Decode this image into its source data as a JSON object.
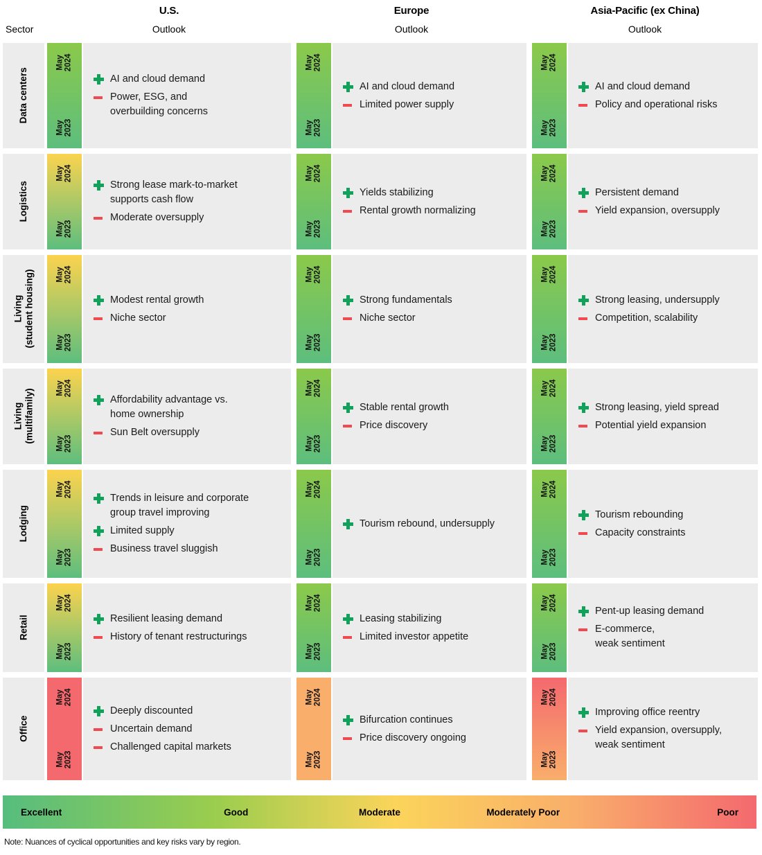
{
  "columns": {
    "sector_header": "Sector",
    "regions": [
      {
        "name": "U.S.",
        "sub": "Outlook"
      },
      {
        "name": "Europe",
        "sub": "Outlook"
      },
      {
        "name": "Asia-Pacific (ex China)",
        "sub": "Outlook"
      }
    ]
  },
  "scale_labels": {
    "top": "May\n2024",
    "bottom": "May\n2023"
  },
  "colors": {
    "panel_bg": "#ececec",
    "plus": "#12a15a",
    "minus": "#f0494f",
    "excellent": "#56bd7e",
    "good": "#9acd4e",
    "moderate": "#fbd45a",
    "moderately_poor": "#f9ae6b",
    "poor": "#f4696e"
  },
  "rows": [
    {
      "sector": "Data centers",
      "cells": [
        {
          "region": "U.S.",
          "grad_top": "#8bc94a",
          "grad_bottom": "#5dbe7e",
          "bullets": [
            {
              "type": "plus",
              "text": "AI and cloud demand"
            },
            {
              "type": "minus",
              "text": "Power, ESG, and\noverbuilding concerns"
            }
          ]
        },
        {
          "region": "Europe",
          "grad_top": "#8bc94a",
          "grad_bottom": "#5dbe7e",
          "bullets": [
            {
              "type": "plus",
              "text": "AI and cloud demand"
            },
            {
              "type": "minus",
              "text": "Limited power supply"
            }
          ]
        },
        {
          "region": "Asia-Pacific (ex China)",
          "grad_top": "#8bc94a",
          "grad_bottom": "#5dbe7e",
          "bullets": [
            {
              "type": "plus",
              "text": "AI and cloud demand"
            },
            {
              "type": "minus",
              "text": "Policy and operational risks"
            }
          ]
        }
      ]
    },
    {
      "sector": "Logistics",
      "cells": [
        {
          "region": "U.S.",
          "grad_top": "#fbd34f",
          "grad_bottom": "#5dbe7e",
          "bullets": [
            {
              "type": "plus",
              "text": "Strong lease mark-to-market\nsupports cash flow"
            },
            {
              "type": "minus",
              "text": "Moderate oversupply"
            }
          ]
        },
        {
          "region": "Europe",
          "grad_top": "#8bc94a",
          "grad_bottom": "#5dbe7e",
          "bullets": [
            {
              "type": "plus",
              "text": "Yields stabilizing"
            },
            {
              "type": "minus",
              "text": "Rental growth normalizing"
            }
          ]
        },
        {
          "region": "Asia-Pacific (ex China)",
          "grad_top": "#8bc94a",
          "grad_bottom": "#5dbe7e",
          "bullets": [
            {
              "type": "plus",
              "text": "Persistent demand"
            },
            {
              "type": "minus",
              "text": "Yield expansion, oversupply"
            }
          ]
        }
      ]
    },
    {
      "sector": "Living\n(student housing)",
      "cells": [
        {
          "region": "U.S.",
          "grad_top": "#fcd34e",
          "grad_bottom": "#5dbe7e",
          "bullets": [
            {
              "type": "plus",
              "text": "Modest rental growth"
            },
            {
              "type": "minus",
              "text": "Niche sector"
            }
          ]
        },
        {
          "region": "Europe",
          "grad_top": "#8bc94a",
          "grad_bottom": "#5dbe7e",
          "bullets": [
            {
              "type": "plus",
              "text": "Strong fundamentals"
            },
            {
              "type": "minus",
              "text": "Niche sector"
            }
          ]
        },
        {
          "region": "Asia-Pacific (ex China)",
          "grad_top": "#8bc94a",
          "grad_bottom": "#5dbe7e",
          "bullets": [
            {
              "type": "plus",
              "text": "Strong leasing, undersupply"
            },
            {
              "type": "minus",
              "text": "Competition, scalability"
            }
          ]
        }
      ]
    },
    {
      "sector": "Living\n(multifamily)",
      "cells": [
        {
          "region": "U.S.",
          "grad_top": "#fcd34e",
          "grad_bottom": "#5dbe7e",
          "bullets": [
            {
              "type": "plus",
              "text": "Affordability advantage vs.\nhome ownership"
            },
            {
              "type": "minus",
              "text": "Sun Belt oversupply"
            }
          ]
        },
        {
          "region": "Europe",
          "grad_top": "#8bc94a",
          "grad_bottom": "#5dbe7e",
          "bullets": [
            {
              "type": "plus",
              "text": "Stable rental growth"
            },
            {
              "type": "minus",
              "text": "Price discovery"
            }
          ]
        },
        {
          "region": "Asia-Pacific (ex China)",
          "grad_top": "#8bc94a",
          "grad_bottom": "#5dbe7e",
          "bullets": [
            {
              "type": "plus",
              "text": "Strong leasing, yield spread"
            },
            {
              "type": "minus",
              "text": "Potential yield expansion"
            }
          ]
        }
      ]
    },
    {
      "sector": "Lodging",
      "cells": [
        {
          "region": "U.S.",
          "grad_top": "#fcd34e",
          "grad_bottom": "#5dbe7e",
          "bullets": [
            {
              "type": "plus",
              "text": "Trends in leisure and corporate\ngroup travel improving"
            },
            {
              "type": "plus",
              "text": "Limited supply"
            },
            {
              "type": "minus",
              "text": "Business travel sluggish"
            }
          ]
        },
        {
          "region": "Europe",
          "grad_top": "#8bc94a",
          "grad_bottom": "#5dbe7e",
          "bullets": [
            {
              "type": "plus",
              "text": "Tourism rebound, undersupply"
            }
          ]
        },
        {
          "region": "Asia-Pacific (ex China)",
          "grad_top": "#8bc94a",
          "grad_bottom": "#5dbe7e",
          "bullets": [
            {
              "type": "plus",
              "text": "Tourism rebounding"
            },
            {
              "type": "minus",
              "text": "Capacity constraints"
            }
          ]
        }
      ]
    },
    {
      "sector": "Retail",
      "cells": [
        {
          "region": "U.S.",
          "grad_top": "#fcd34e",
          "grad_bottom": "#5dbe7e",
          "bullets": [
            {
              "type": "plus",
              "text": "Resilient leasing demand"
            },
            {
              "type": "minus",
              "text": "History of tenant restructurings"
            }
          ]
        },
        {
          "region": "Europe",
          "grad_top": "#8bc94a",
          "grad_bottom": "#5dbe7e",
          "bullets": [
            {
              "type": "plus",
              "text": "Leasing stabilizing"
            },
            {
              "type": "minus",
              "text": "Limited investor appetite"
            }
          ]
        },
        {
          "region": "Asia-Pacific (ex China)",
          "grad_top": "#8bc94a",
          "grad_bottom": "#5dbe7e",
          "bullets": [
            {
              "type": "plus",
              "text": "Pent-up leasing demand"
            },
            {
              "type": "minus",
              "text": "E-commerce,\nweak sentiment"
            }
          ]
        }
      ]
    },
    {
      "sector": "Office",
      "cells": [
        {
          "region": "U.S.",
          "grad_top": "#f4696e",
          "grad_bottom": "#f4696e",
          "bullets": [
            {
              "type": "plus",
              "text": "Deeply discounted"
            },
            {
              "type": "minus",
              "text": "Uncertain demand"
            },
            {
              "type": "minus",
              "text": "Challenged capital markets"
            }
          ]
        },
        {
          "region": "Europe",
          "grad_top": "#f9ae6b",
          "grad_bottom": "#f9ae6b",
          "bullets": [
            {
              "type": "plus",
              "text": "Bifurcation continues"
            },
            {
              "type": "minus",
              "text": "Price discovery ongoing"
            }
          ]
        },
        {
          "region": "Asia-Pacific (ex China)",
          "grad_top": "#f4696e",
          "grad_bottom": "#f9ae6b",
          "bullets": [
            {
              "type": "plus",
              "text": "Improving office reentry"
            },
            {
              "type": "minus",
              "text": "Yield expansion, oversupply,\nweak sentiment"
            }
          ]
        }
      ]
    }
  ],
  "legend": {
    "stops": [
      "Excellent",
      "Good",
      "Moderate",
      "Moderately Poor",
      "Poor"
    ]
  },
  "note": "Note: Nuances of cyclical opportunities and key risks vary by region."
}
